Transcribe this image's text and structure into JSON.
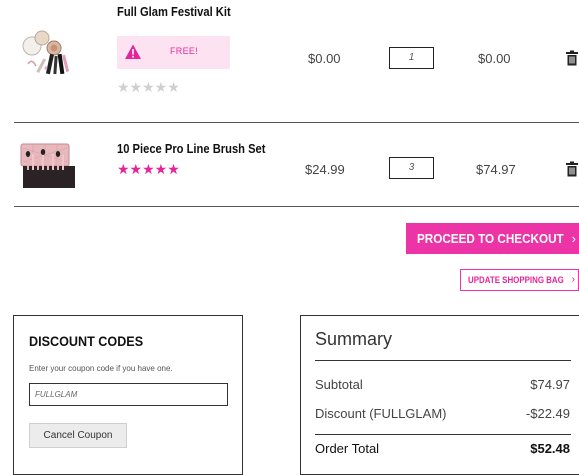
{
  "cart": {
    "items": [
      {
        "name": "Full Glam Festival Kit",
        "badge": "FREE!",
        "rating": 0,
        "unit_price": "$0.00",
        "quantity": "1",
        "line_total": "$0.00",
        "thumbnail_icon": "makeup-kit-image"
      },
      {
        "name": "10 Piece Pro Line Brush Set",
        "rating": 5,
        "unit_price": "$24.99",
        "quantity": "3",
        "line_total": "$74.97",
        "thumbnail_icon": "brush-set-image"
      }
    ],
    "stars_empty": "★★★★★",
    "stars_full": "★★★★★"
  },
  "actions": {
    "checkout_label": "PROCEED TO CHECKOUT",
    "update_label": "UPDATE SHOPPING BAG"
  },
  "discount": {
    "title": "DISCOUNT CODES",
    "hint": "Enter your coupon code if you have one.",
    "coupon_value": "FULLGLAM",
    "cancel_label": "Cancel Coupon"
  },
  "summary": {
    "title": "Summary",
    "subtotal_label": "Subtotal",
    "subtotal_value": "$74.97",
    "discount_label": "Discount (FULLGLAM)",
    "discount_value": "-$22.49",
    "total_label": "Order Total",
    "total_value": "$52.48"
  },
  "colors": {
    "accent": "#ec34a6",
    "badge_bg": "#fde3f2",
    "star_empty": "#d0d0d0"
  }
}
